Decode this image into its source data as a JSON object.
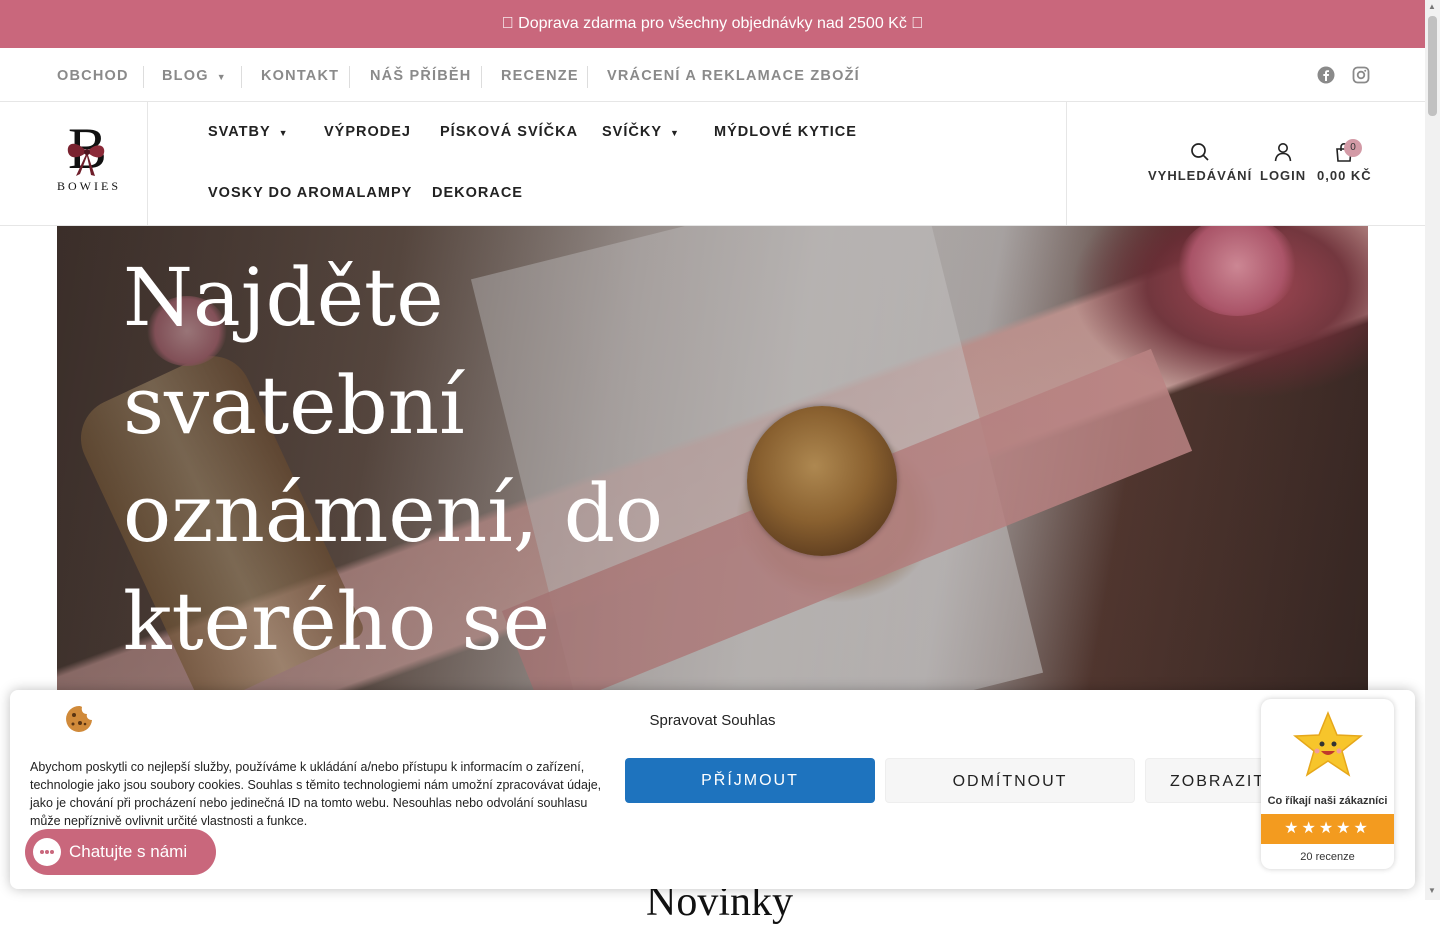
{
  "promo_bar": {
    "text": "\u0000 Doprava zdarma pro všechny objednávky nad 2500 Kč \u0000"
  },
  "secondary_nav": {
    "items": [
      {
        "label": "OBCHOD"
      },
      {
        "label": "BLOG"
      },
      {
        "label": "KONTAKT"
      },
      {
        "label": "NÁŠ PŘÍBĚH"
      },
      {
        "label": "RECENZE"
      },
      {
        "label": "VRÁCENÍ A REKLAMACE ZBOŽÍ"
      }
    ],
    "social": [
      "facebook-icon",
      "instagram-icon"
    ]
  },
  "logo": {
    "letter": "B",
    "name": "BOWIES"
  },
  "main_nav": {
    "items": [
      {
        "label": "SVATBY"
      },
      {
        "label": "VÝPRODEJ"
      },
      {
        "label": "PÍSKOVÁ SVÍČKA"
      },
      {
        "label": "SVÍČKY"
      },
      {
        "label": "MÝDLOVÉ KYTICE"
      },
      {
        "label": "VOSKY DO AROMALAMPY"
      },
      {
        "label": "DEKORACE"
      }
    ]
  },
  "account": {
    "search_label": "VYHLEDÁVÁNÍ",
    "login_label": "LOGIN",
    "cart_total": "0,00 KČ",
    "cart_count": "0"
  },
  "hero": {
    "title": "Najděte svatební oznámení, do kterého se zamilujete"
  },
  "section": {
    "heading": "Novinky"
  },
  "cookie_banner": {
    "title": "Spravovat Souhlas",
    "text": "Abychom poskytli co nejlepší služby, používáme k ukládání a/nebo přístupu k informacím o zařízení, technologie jako jsou soubory cookies. Souhlas s těmito technologiemi nám umožní zpracovávat údaje, jako je chování při procházení nebo jedinečná ID na tomto webu. Nesouhlas nebo odvolání souhlasu může nepříznivě ovlivnit určité vlastnosti a funkce.",
    "accept_label": "PŘÍJMOUT",
    "deny_label": "ODMÍTNOUT",
    "view_label": "ZOBRAZIT"
  },
  "chat": {
    "label": "Chatujte s námi"
  },
  "reviews_widget": {
    "title": "Co říkají naši zákazníci",
    "stars": "★★★★★",
    "count": "20 recenze"
  },
  "colors": {
    "brand_pink": "#c9677c",
    "accept_blue": "#1e73be",
    "star_orange": "#f39b1f"
  }
}
